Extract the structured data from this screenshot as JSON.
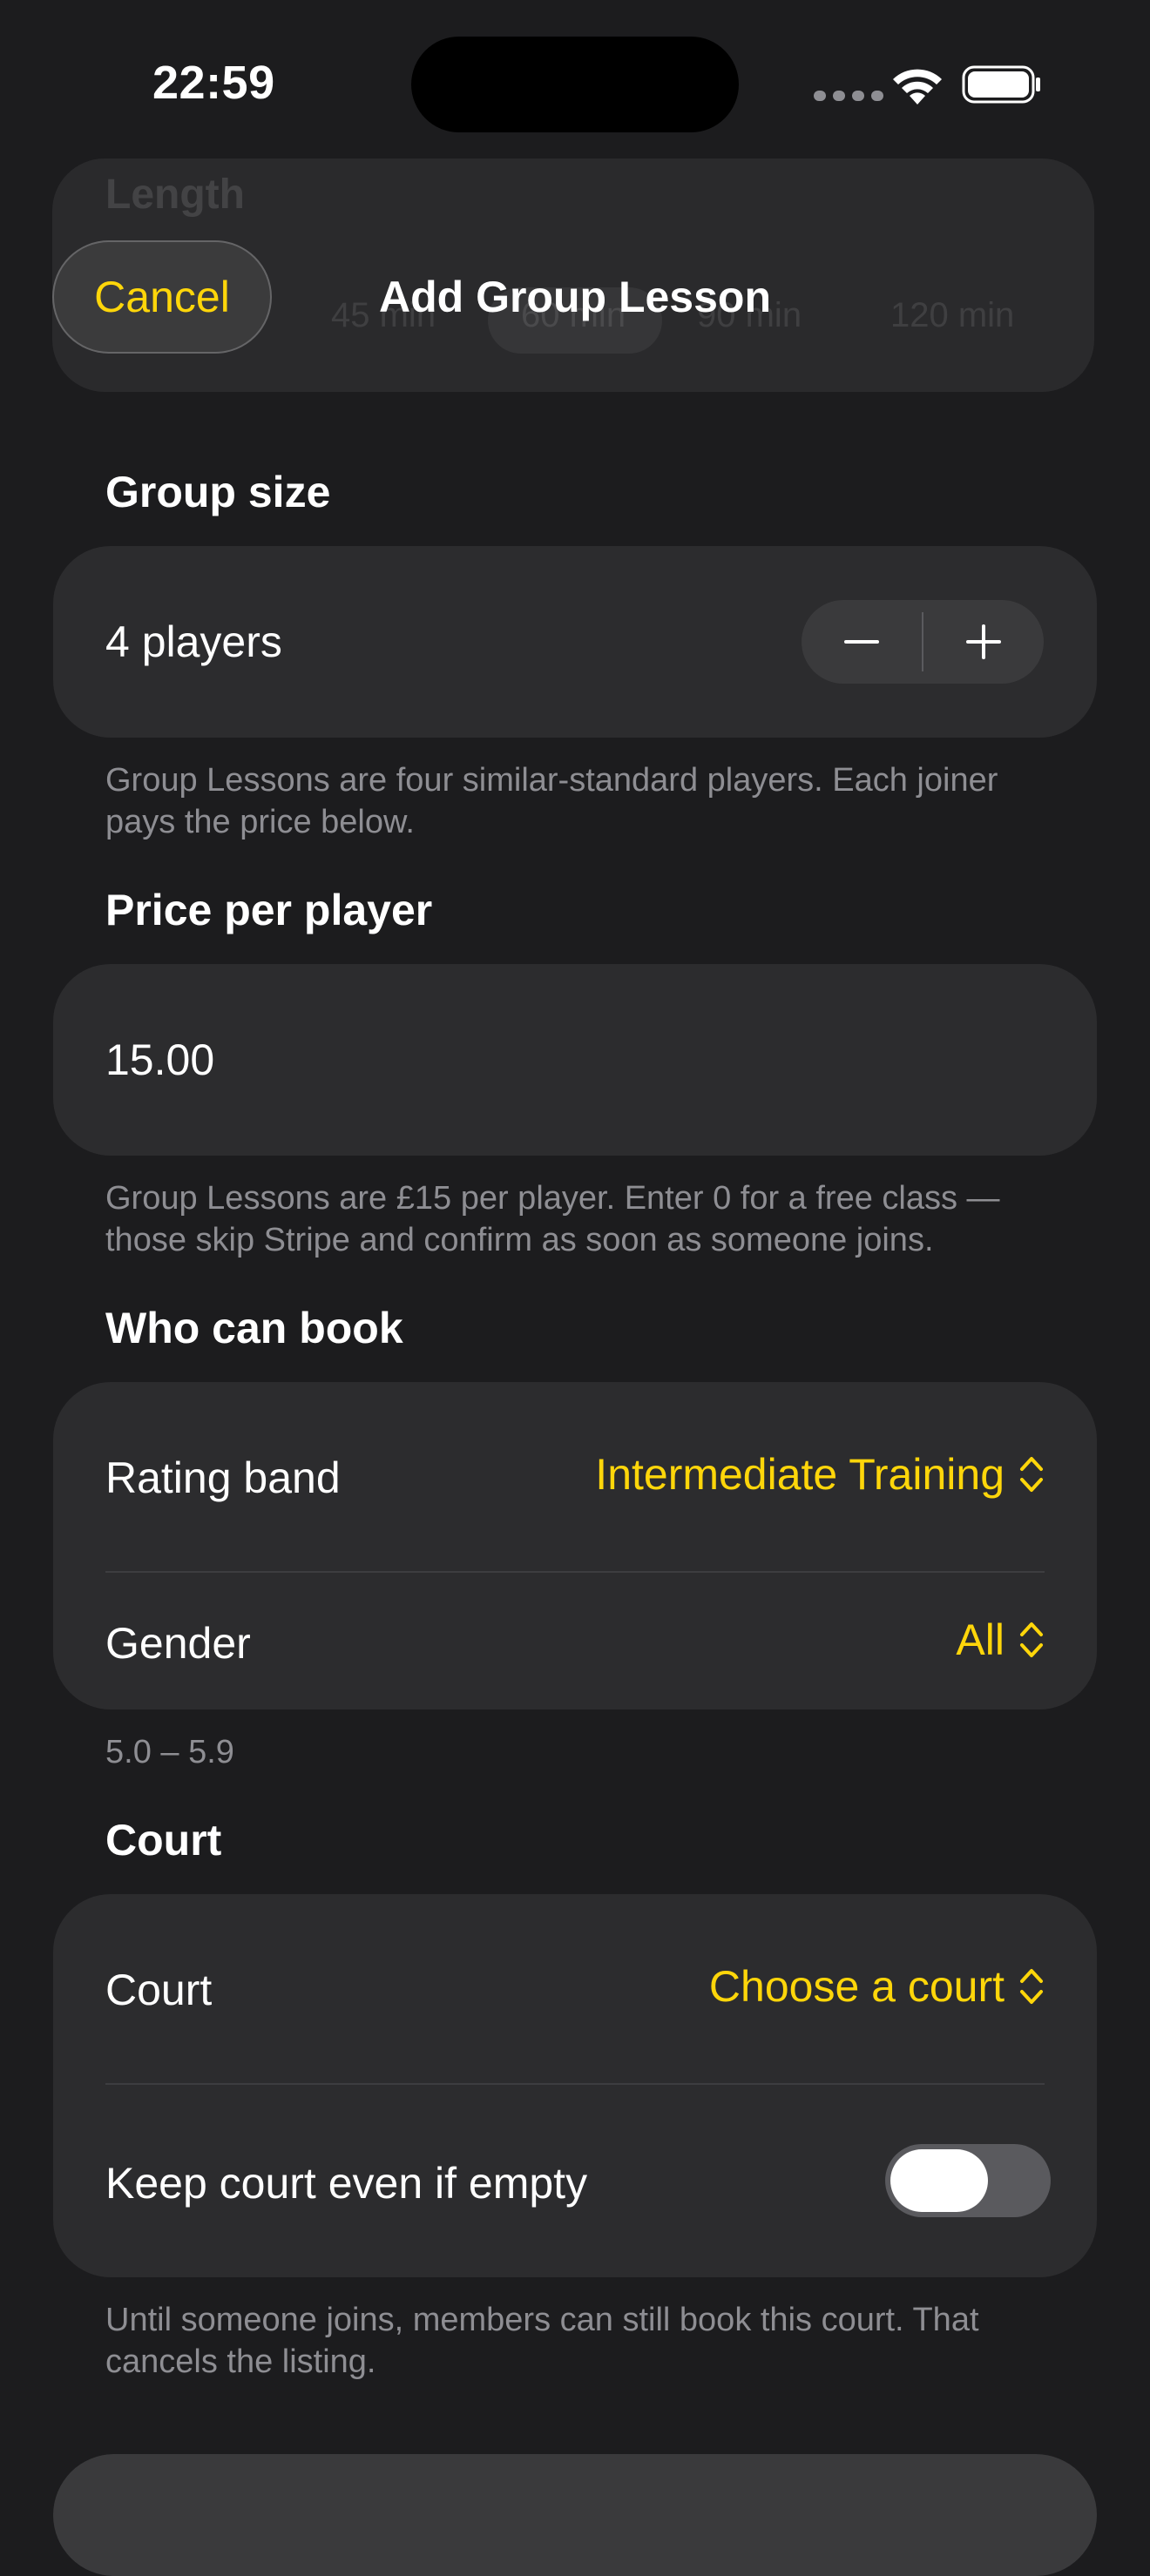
{
  "status_bar": {
    "time": "22:59"
  },
  "nav": {
    "cancel_label": "Cancel",
    "title": "Add Group Lesson"
  },
  "behind_header": {
    "section_label": "Length",
    "segments": [
      "45 min",
      "60 min",
      "90 min",
      "120 min"
    ]
  },
  "group_size": {
    "section_title": "Group size",
    "value_label": "4 players",
    "footnote": "Group Lessons are four similar-standard players. Each joiner pays the price below."
  },
  "price": {
    "section_title": "Price per player",
    "value": "15.00",
    "footnote": "Group Lessons are £15 per player. Enter 0 for a free class — those skip Stripe and confirm as soon as someone joins."
  },
  "who_can_book": {
    "section_title": "Who can book",
    "rating_label": "Rating band",
    "rating_value": "Intermediate Training",
    "gender_label": "Gender",
    "gender_value": "All",
    "footnote": "5.0 – 5.9"
  },
  "court": {
    "section_title": "Court",
    "court_label": "Court",
    "court_value": "Choose a court",
    "keep_label": "Keep court even if empty",
    "keep_on": false,
    "footnote": "Until someone joins, members can still book this court. That cancels the listing."
  },
  "colors": {
    "accent": "#ffd60a",
    "background": "#1c1c1e",
    "card": "#2c2c2e",
    "secondary_text": "#8e8e93"
  }
}
